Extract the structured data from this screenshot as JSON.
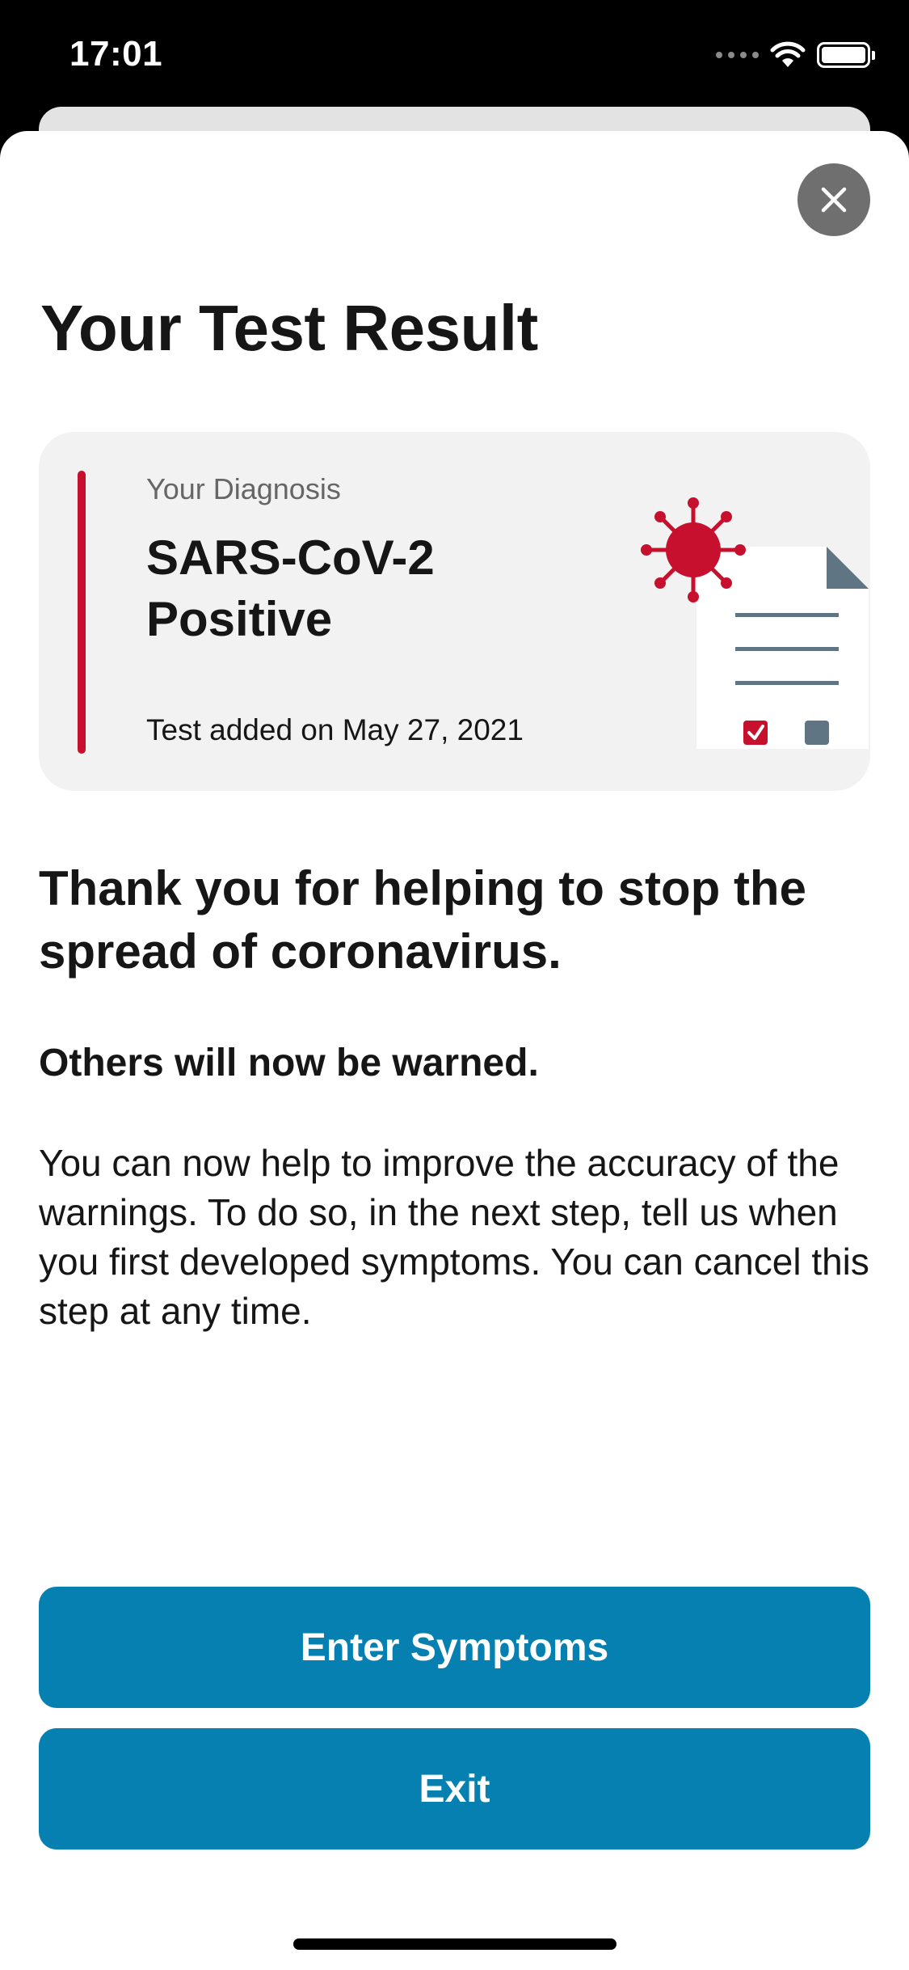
{
  "status_bar": {
    "time": "17:01",
    "icons": [
      "signal-dots-icon",
      "wifi-icon",
      "battery-icon"
    ]
  },
  "page": {
    "title": "Your Test Result",
    "close_icon": "close-icon"
  },
  "result_card": {
    "label": "Your Diagnosis",
    "diagnosis": "SARS-CoV-2 Positive",
    "date": "Test added on May 27, 2021",
    "accent_color": "#c6102e",
    "illustration": "virus-document-illustration"
  },
  "content": {
    "heading": "Thank you for helping to stop the spread of coronavirus.",
    "subheading": "Others will now be warned.",
    "body": "You can now help to improve the accuracy of the warnings. To do so, in the next step, tell us when you first developed symptoms. You can cancel this step at any time."
  },
  "buttons": {
    "enter_symptoms": "Enter Symptoms",
    "exit": "Exit",
    "color": "#0580b0"
  }
}
